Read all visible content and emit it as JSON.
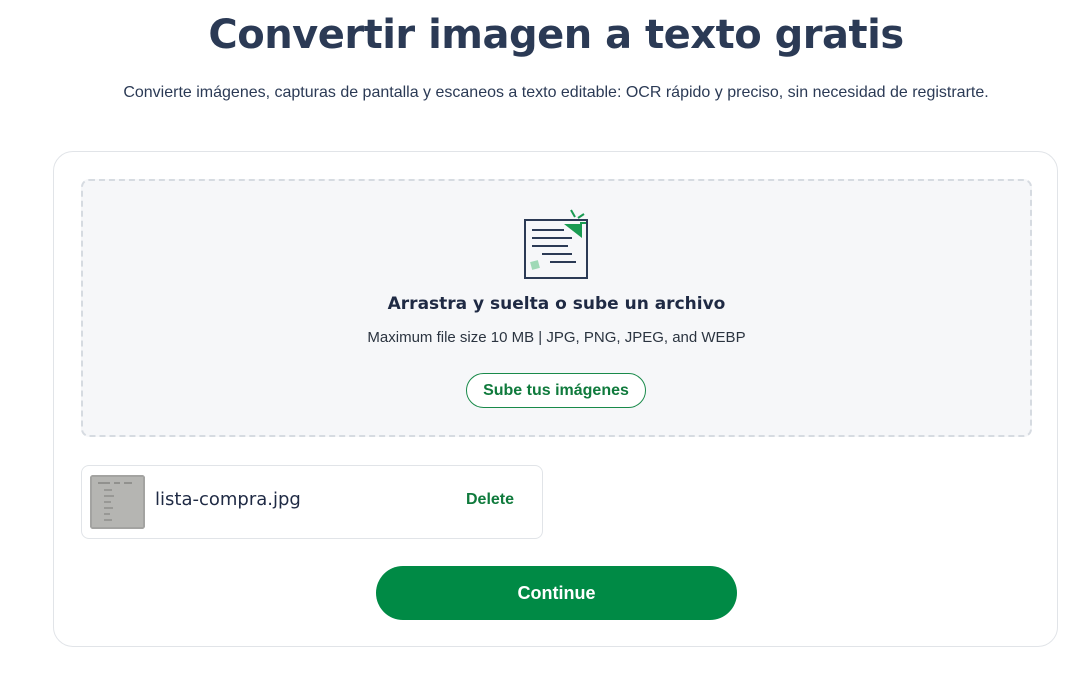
{
  "header": {
    "title": "Convertir imagen a texto gratis",
    "subtitle": "Convierte imágenes, capturas de pantalla y escaneos a texto editable: OCR rápido y preciso, sin necesidad de registrarte."
  },
  "upload": {
    "icon": "document-scan-icon",
    "title": "Arrastra y suelta o sube un archivo",
    "hint": "Maximum file size 10 MB | JPG, PNG, JPEG, and WEBP",
    "button_label": "Sube tus imágenes"
  },
  "files": [
    {
      "name": "lista-compra.jpg",
      "delete_label": "Delete",
      "thumbnail": "image-thumbnail"
    }
  ],
  "actions": {
    "continue_label": "Continue"
  },
  "colors": {
    "accent": "#008a45",
    "title": "#2b3a55",
    "dropzone_bg": "#f6f7f9"
  }
}
